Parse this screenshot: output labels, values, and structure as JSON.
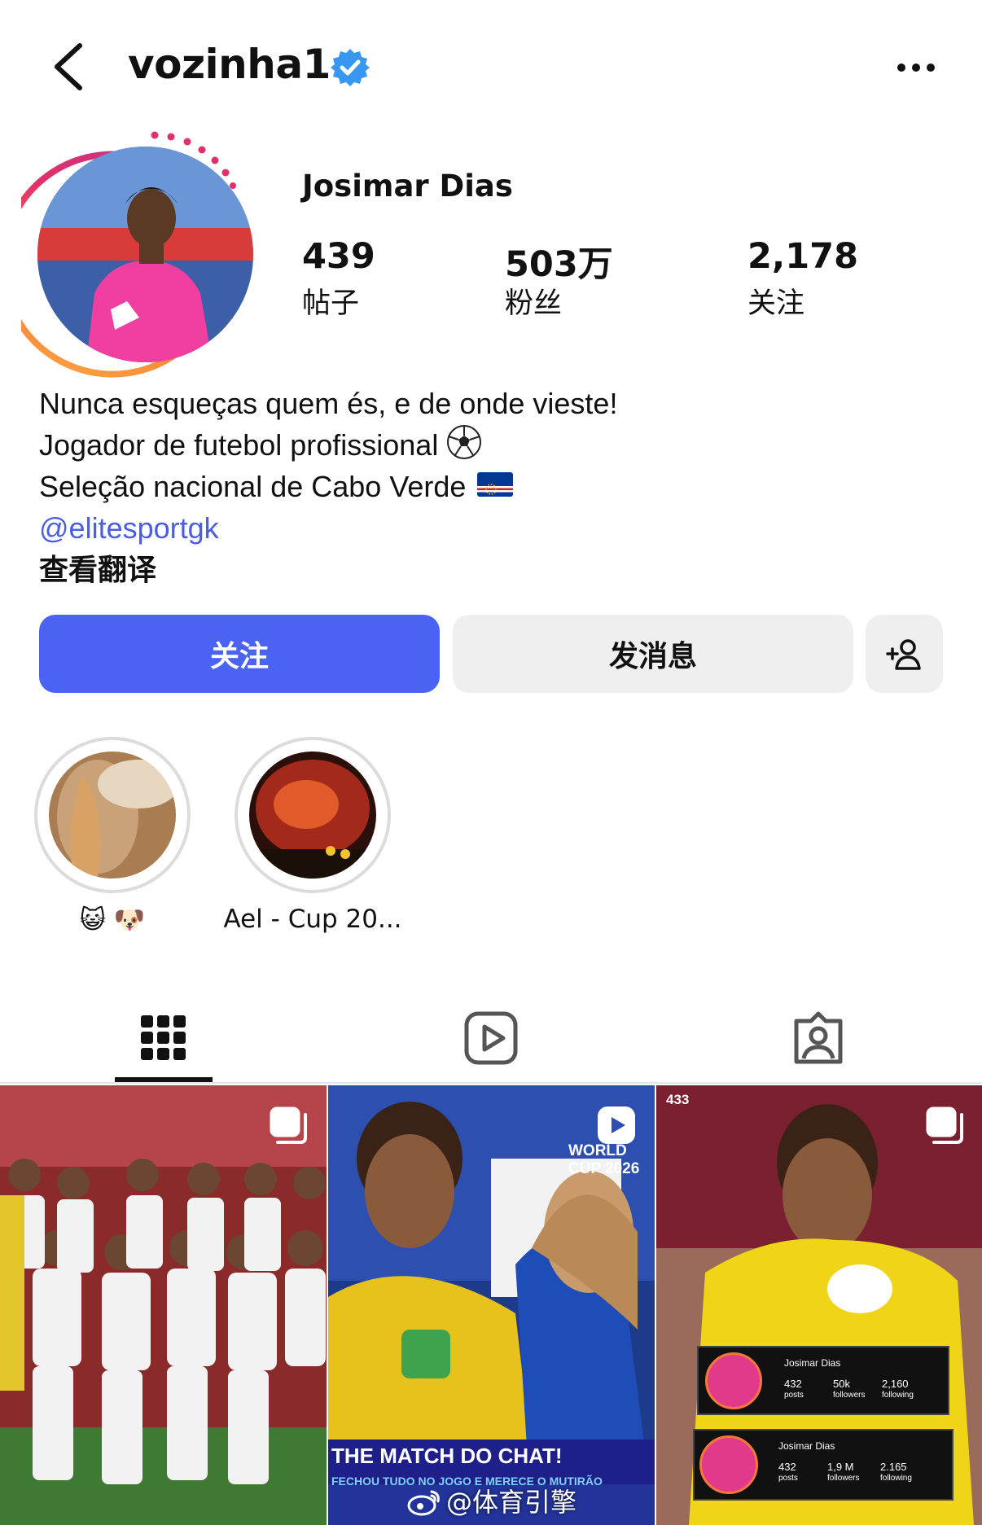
{
  "header": {
    "username": "vozinha1",
    "verified": true,
    "back_icon": "chevron-left-icon",
    "more_icon": "more-dots-icon"
  },
  "profile": {
    "display_name": "Josimar Dias",
    "stats": [
      {
        "value": "439",
        "label": "帖子"
      },
      {
        "value": "503万",
        "label": "粉丝"
      },
      {
        "value": "2,178",
        "label": "关注"
      }
    ],
    "bio": {
      "line1": "Nunca esqueças quem és, e de onde vieste!",
      "line2": "Jogador de futebol profissional",
      "line3": "Seleção nacional de Cabo Verde",
      "link": "@elitesportgk",
      "translate": "查看翻译"
    }
  },
  "actions": {
    "follow_label": "关注",
    "message_label": "发消息",
    "add_user_icon": "add-user-icon",
    "follow_color": "#4b63f2"
  },
  "highlights": [
    {
      "label": "😺 🐶"
    },
    {
      "label": "Ael - Cup 20..."
    }
  ],
  "tabs": [
    {
      "icon": "grid-icon",
      "active": true
    },
    {
      "icon": "reels-icon",
      "active": false
    },
    {
      "icon": "tagged-icon",
      "active": false
    }
  ],
  "posts": [
    {
      "type": "carousel",
      "caption": ""
    },
    {
      "type": "reel",
      "overlay_title": "THE MATCH DO CHAT!",
      "overlay_sub": "FECHOU TUDO NO JOGO E MERECE O MUTIRÃO",
      "badge": "WORLD CUP 2026"
    },
    {
      "type": "carousel",
      "source": "433",
      "cards": [
        {
          "name": "Josimar Dias",
          "posts": "432",
          "posts_label": "posts",
          "followers": "50k",
          "followers_label": "followers",
          "following": "2,160",
          "following_label": "following"
        },
        {
          "name": "Josimar Dias",
          "posts": "432",
          "posts_label": "posts",
          "followers": "1,9 M",
          "followers_label": "followers",
          "following": "2.165",
          "following_label": "following"
        }
      ]
    }
  ],
  "watermark": "@体育引擎"
}
